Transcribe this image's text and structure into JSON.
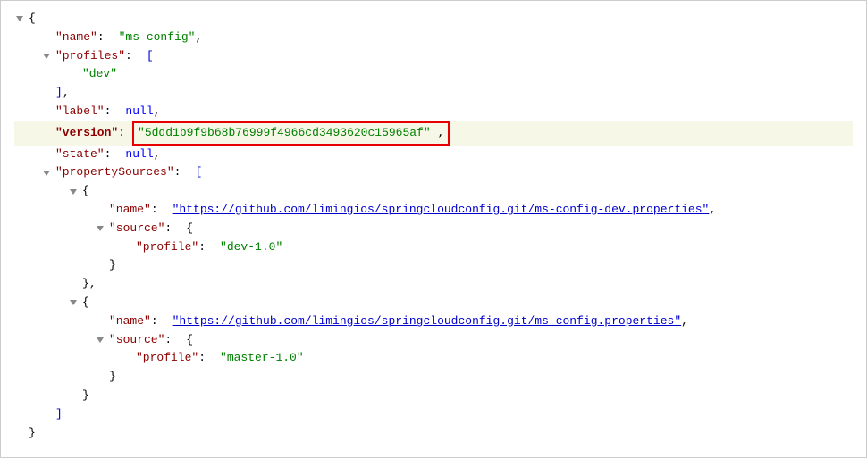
{
  "keys": {
    "name": "\"name\"",
    "profiles": "\"profiles\"",
    "dev": "\"dev\"",
    "label": "\"label\"",
    "version": "\"version\"",
    "state": "\"state\"",
    "propertySources": "\"propertySources\"",
    "source": "\"source\"",
    "profile": "\"profile\""
  },
  "values": {
    "msConfig": "\"ms-config\"",
    "versionHash": "\"5ddd1b9f9b68b76999f4966cd3493620c15965af\"",
    "null": "null",
    "url1": "\"https://github.com/limingios/springcloudconfig.git/ms-config-dev.properties\"",
    "url2": "\"https://github.com/limingios/springcloudconfig.git/ms-config.properties\"",
    "dev10": "\"dev-1.0\"",
    "master10": "\"master-1.0\""
  },
  "punct": {
    "colon": ":",
    "comma": ",",
    "openBrace": "{",
    "closeBrace": "}",
    "openBracket": "[",
    "closeBracket": "]"
  }
}
